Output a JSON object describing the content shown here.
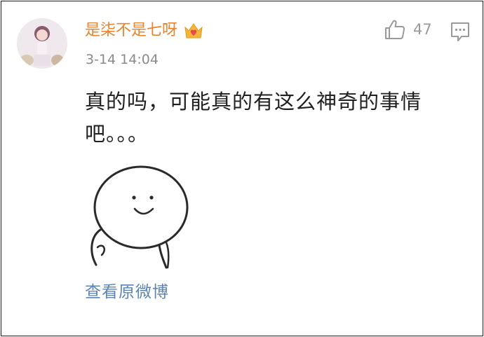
{
  "comment": {
    "username": "是柒不是七呀",
    "badge_icon": "crown-heart-icon",
    "timestamp": "3-14 14:04",
    "like_count": "47",
    "text": "真的吗，可能真的有这么神奇的事情吧。。。",
    "sticker": "smiling-face-sticker",
    "view_original": "查看原微博"
  },
  "colors": {
    "username": "#e8832f",
    "link": "#5b84b5",
    "meta": "#8a8a8a"
  }
}
